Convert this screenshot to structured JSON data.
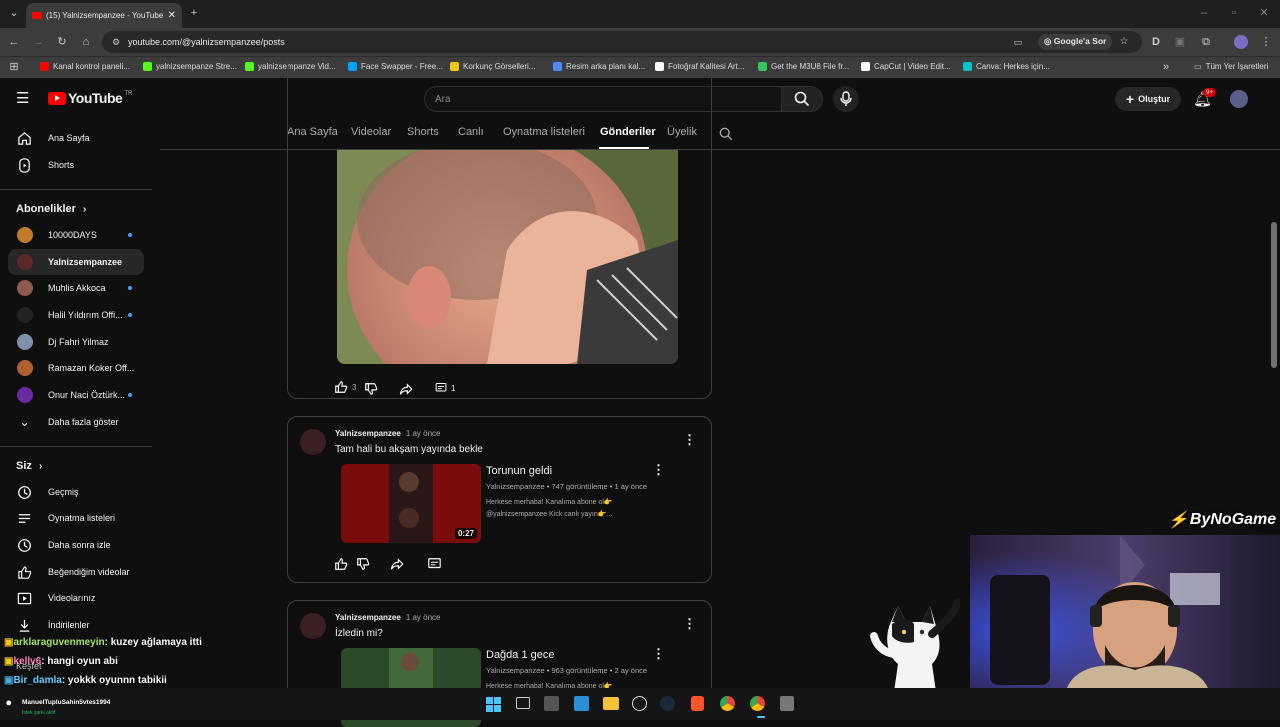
{
  "browser": {
    "tab_title": "(15) Yalnizsempanzee - YouTube",
    "url": "youtube.com/@yalnizsempanzee/posts",
    "ask_google": "Google'a Sor",
    "bookmarks": [
      {
        "label": "Kanal kontrol paneli...",
        "color": "#ff0000"
      },
      {
        "label": "yalnizsempanze Stre...",
        "color": "#53fc18"
      },
      {
        "label": "yalnizsempanze Vid...",
        "color": "#53fc18"
      },
      {
        "label": "Face Swapper - Free...",
        "color": "#00a2ff"
      },
      {
        "label": "Korkunç Görselleri...",
        "color": "#f5c518"
      },
      {
        "label": "Resim arka planı kal...",
        "color": "#4a8cff"
      },
      {
        "label": "Fotoğraf Kalitesi Art...",
        "color": "#ffffff"
      },
      {
        "label": "Get the M3U8 File fr...",
        "color": "#34c759"
      },
      {
        "label": "CapCut | Video Edit...",
        "color": "#ffffff"
      },
      {
        "label": "Canva: Herkes için...",
        "color": "#00c4cc"
      }
    ],
    "all_bookmarks": "Tüm Yer İşaretleri"
  },
  "youtube": {
    "logo": "YouTube",
    "logo_region": "TR",
    "search_placeholder": "Ara",
    "create_label": "Oluştur",
    "notif_badge": "9+"
  },
  "channel_tabs": [
    "Ana Sayfa",
    "Videolar",
    "Shorts",
    "Canlı",
    "Oynatma listeleri",
    "Gönderiler",
    "Üyelik"
  ],
  "active_tab": "Gönderiler",
  "sidebar": {
    "top": [
      "Ana Sayfa",
      "Shorts"
    ],
    "subs_header": "Abonelikler",
    "subs": [
      {
        "name": "10000DAYS",
        "dot": true,
        "color": "#c07a2a"
      },
      {
        "name": "Yalnizsempanzee",
        "dot": false,
        "color": "#5a2a2a"
      },
      {
        "name": "Muhlis Akkoca",
        "dot": true,
        "color": "#8a5a4a"
      },
      {
        "name": "Halil Yıldırım Offi...",
        "dot": true,
        "color": "#222222"
      },
      {
        "name": "Dj Fahri Yilmaz",
        "dot": false,
        "color": "#7f8fa8"
      },
      {
        "name": "Ramazan Koker Off...",
        "dot": false,
        "color": "#b06030"
      },
      {
        "name": "Onur Naci Öztürk...",
        "dot": true,
        "color": "#6a2aa0"
      }
    ],
    "show_more": "Daha fazla göster",
    "you_header": "Siz",
    "you": [
      "Geçmiş",
      "Oynatma listeleri",
      "Daha sonra izle",
      "Beğendiğim videolar",
      "Videolarınız",
      "İndirilenler"
    ]
  },
  "post1": {
    "likes": "3",
    "comments": "1"
  },
  "posts": [
    {
      "channel": "Yalnizsempanzee",
      "time": "1 ay önce",
      "text": "Tam hali bu akşam yayında bekle",
      "video_title": "Torunun geldi",
      "video_meta": "Yalnizsempanzee • 747 görüntüleme • 1 ay önce",
      "video_desc": [
        "Herkese merhaba! Kanalıma abone ol👉",
        "@yalnizsempanzee Kick canlı yayın👉..."
      ],
      "duration": "0:27"
    },
    {
      "channel": "Yalnizsempanzee",
      "time": "1 ay önce",
      "text": "İzledin mi?",
      "video_title": "Dağda 1 gece",
      "video_meta": "Yalnizsempanzee • 963 görüntüleme • 2 ay önce",
      "video_desc": [
        "Herkese merhaba! Kanalıma abone ol👉"
      ]
    }
  ],
  "overlay": {
    "watermark": "ByNoGame",
    "chat": [
      {
        "user": "arklaraguvenmeyin",
        "msg": ": kuzey ağlamaya itti",
        "color": "#a8e060"
      },
      {
        "user": "kellv6",
        "msg": ": hangi oyun abi",
        "color": "#ff7fbf"
      },
      {
        "user": "Bir_damla",
        "msg": ": yokkk oyunnn tabikii",
        "color": "#66ccff"
      }
    ],
    "explore_partial": "Keşfet",
    "spotify_user": "ManuelTupluSahin5vtes1994",
    "spotify_sub": "İstek şarkı aktif"
  }
}
